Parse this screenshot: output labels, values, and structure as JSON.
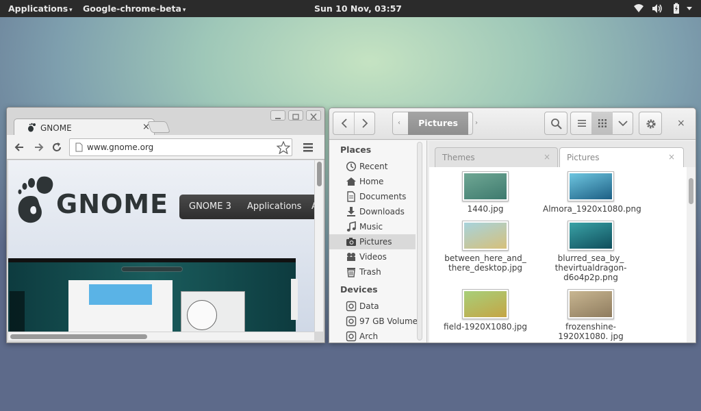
{
  "topbar": {
    "applications": "Applications",
    "app_name": "Google-chrome-beta",
    "clock": "Sun 10 Nov, 03:57",
    "caret": "▾",
    "icons": [
      "wifi-icon",
      "volume-icon",
      "battery-icon",
      "system-menu-icon"
    ]
  },
  "chrome": {
    "tab_title": "GNOME",
    "tab_close": "×",
    "url": "www.gnome.org",
    "page": {
      "logo_text": "GNOME",
      "nav_items": [
        "GNOME 3",
        "Applications",
        "A"
      ]
    }
  },
  "files": {
    "path_current": "Pictures",
    "close": "×",
    "sidebar": {
      "places_heading": "Places",
      "places": [
        {
          "label": "Recent",
          "icon": "clock-icon"
        },
        {
          "label": "Home",
          "icon": "home-icon"
        },
        {
          "label": "Documents",
          "icon": "document-icon"
        },
        {
          "label": "Downloads",
          "icon": "download-icon"
        },
        {
          "label": "Music",
          "icon": "music-icon"
        },
        {
          "label": "Pictures",
          "icon": "camera-icon",
          "selected": true
        },
        {
          "label": "Videos",
          "icon": "video-icon"
        },
        {
          "label": "Trash",
          "icon": "trash-icon"
        }
      ],
      "devices_heading": "Devices",
      "devices": [
        {
          "label": "Data",
          "icon": "drive-icon"
        },
        {
          "label": "97 GB Volume",
          "icon": "drive-icon"
        },
        {
          "label": "Arch",
          "icon": "drive-icon"
        }
      ]
    },
    "tabs": [
      {
        "label": "Themes",
        "active": false
      },
      {
        "label": "Pictures",
        "active": true
      }
    ],
    "files": [
      {
        "name": "1440.jpg",
        "colors": [
          "#6fa794",
          "#3e7a6e"
        ]
      },
      {
        "name": "Almora_1920x1080.png",
        "colors": [
          "#6ec6e0",
          "#1d5f84"
        ]
      },
      {
        "name": "between_here_and_ there_desktop.jpg",
        "colors": [
          "#a7d3dc",
          "#d6c07a"
        ]
      },
      {
        "name": "blurred_sea_by_ thevirtualdragon- d6o4p2p.png",
        "colors": [
          "#3aa2a6",
          "#0f4e5c"
        ]
      },
      {
        "name": "field-1920X1080.jpg",
        "colors": [
          "#a7cf7a",
          "#c5a544"
        ]
      },
      {
        "name": "frozenshine-1920X1080. jpg",
        "colors": [
          "#c8b691",
          "#8e7b5e"
        ]
      }
    ]
  }
}
